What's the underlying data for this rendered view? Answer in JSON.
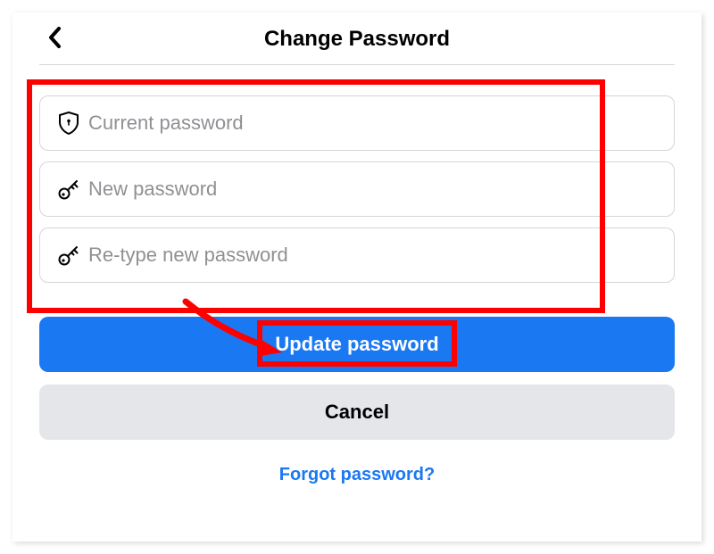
{
  "header": {
    "title": "Change Password"
  },
  "inputs": {
    "current": {
      "placeholder": "Current password",
      "value": ""
    },
    "new": {
      "placeholder": "New password",
      "value": ""
    },
    "retype": {
      "placeholder": "Re-type new password",
      "value": ""
    }
  },
  "buttons": {
    "update": "Update password",
    "cancel": "Cancel"
  },
  "links": {
    "forgot": "Forgot password?"
  },
  "colors": {
    "accent": "#1a78f3",
    "highlight": "#ff0000"
  }
}
